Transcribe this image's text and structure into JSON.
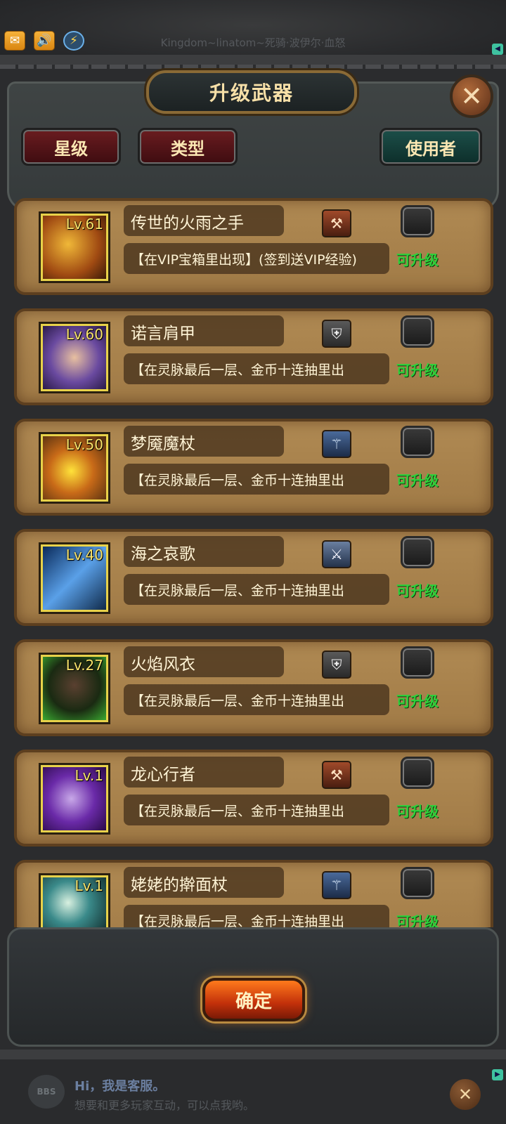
{
  "top_bar": {
    "server_title": "Kingdom~linatom~死骑·波伊尔·血怒",
    "icons": [
      "mail-icon",
      "sound-icon",
      "lightning-icon"
    ]
  },
  "dialog": {
    "title": "升级武器",
    "close_icon": "close-icon",
    "filters": {
      "star_label": "星级",
      "type_label": "类型",
      "user_label": "使用者"
    }
  },
  "items": [
    {
      "level": "Lv.61",
      "name": "传世的火雨之手",
      "source": "【在VIP宝箱里出现】(签到送VIP经验)",
      "type_icon": "weapon-type-icon",
      "status": "可升级",
      "checked": false
    },
    {
      "level": "Lv.60",
      "name": "诺言肩甲",
      "source": "【在灵脉最后一层、金币十连抽里出",
      "type_icon": "armor-type-icon",
      "status": "可升级",
      "checked": false
    },
    {
      "level": "Lv.50",
      "name": "梦魇魔杖",
      "source": "【在灵脉最后一层、金币十连抽里出",
      "type_icon": "staff-type-icon",
      "status": "可升级",
      "checked": false
    },
    {
      "level": "Lv.40",
      "name": "海之哀歌",
      "source": "【在灵脉最后一层、金币十连抽里出",
      "type_icon": "sword-type-icon",
      "status": "可升级",
      "checked": false
    },
    {
      "level": "Lv.27",
      "name": "火焰风衣",
      "source": "【在灵脉最后一层、金币十连抽里出",
      "type_icon": "armor-type-icon",
      "status": "可升级",
      "checked": false
    },
    {
      "level": "Lv.1",
      "name": "龙心行者",
      "source": "【在灵脉最后一层、金币十连抽里出",
      "type_icon": "weapon-type-icon",
      "status": "可升级",
      "checked": false
    },
    {
      "level": "Lv.1",
      "name": "姥姥的擀面杖",
      "source": "【在灵脉最后一层、金币十连抽里出",
      "type_icon": "staff-type-icon",
      "status": "可升级",
      "checked": false
    }
  ],
  "footer": {
    "confirm_label": "确定"
  },
  "helper": {
    "logo_text": "BBS",
    "title": "Hi，我是客服。",
    "subtitle": "想要和更多玩家互动，可以点我哟。"
  },
  "colors": {
    "card_bg": "#a88250",
    "upgradable": "#2dd13a",
    "level_text": "#f8e36a",
    "title_text": "#f7e0a8"
  }
}
